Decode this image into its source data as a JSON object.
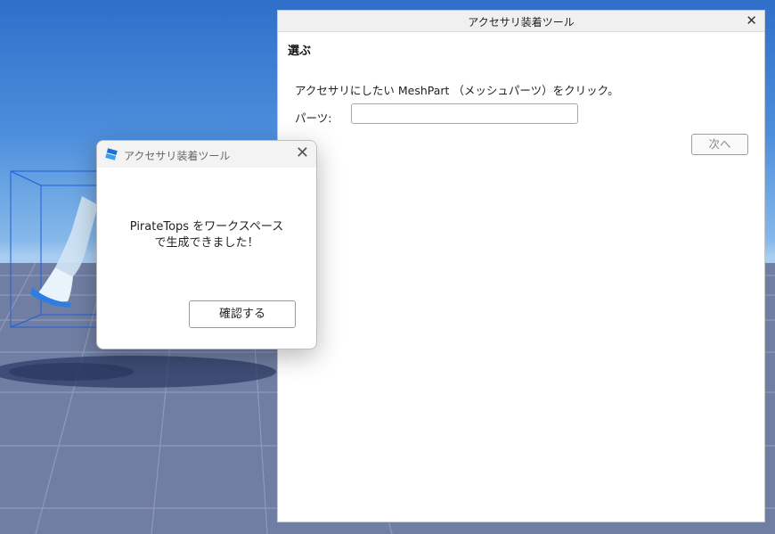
{
  "plugin_window": {
    "title": "アクセサリ装着ツール",
    "close_glyph": "✕",
    "section_title": "選ぶ",
    "instruction": "アクセサリにしたい MeshPart （メッシュパーツ）をクリック。",
    "parts_label": "パーツ:",
    "parts_value": "",
    "next_button": "次へ"
  },
  "popup": {
    "title": "アクセサリ装着ツール",
    "close_glyph": "✕",
    "message_line1": "PirateTops をワークスペース",
    "message_line2": "で生成できました！",
    "confirm_button": "確認する"
  },
  "colors": {
    "sky_top": "#2f6fc9",
    "sky_horizon": "#a9cdf0",
    "ground": "#6c7ba0",
    "selection_box": "#1f5fd6",
    "app_icon": "#1d6fd0"
  },
  "icons": {
    "app": "roblox-studio-icon",
    "close": "close-icon"
  }
}
